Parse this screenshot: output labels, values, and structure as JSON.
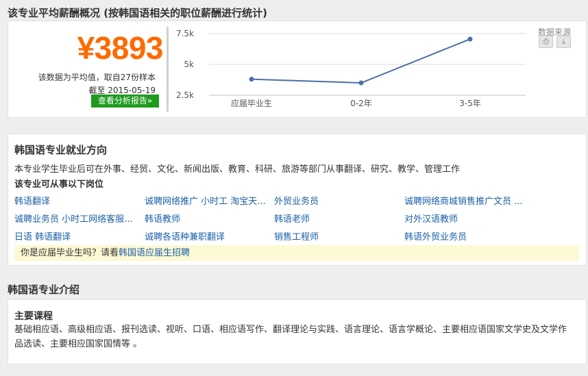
{
  "salary": {
    "section_title": "该专业平均薪酬概况 (按韩国语相关的职位薪酬进行统计)",
    "amount": "¥3893",
    "note_line1": "该数据为平均值，取自27份样本",
    "note_line2": "截至 2015-05-19",
    "report_button": "查看分析报告»",
    "source_label": "数据来源",
    "print_icon": "print-icon",
    "download_icon": "download-icon",
    "accent_color": "#ff6a00",
    "line_color": "#4b6ea8"
  },
  "chart_data": {
    "type": "line",
    "categories": [
      "应届毕业生",
      "0-2年",
      "3-5年"
    ],
    "series": [
      {
        "values": [
          3800,
          3500,
          7050
        ]
      }
    ],
    "y_ticks": [
      "7.5k",
      "5k",
      "2.5k"
    ],
    "ylim": [
      2500,
      7500
    ],
    "grid": true
  },
  "jobs": {
    "title": "韩国语专业就业方向",
    "description": "本专业学生毕业后可在外事、经贸、文化、新闻出版、教育、科研、旅游等部门从事翻译、研究、教学、管理工作",
    "subtitle": "该专业可从事以下岗位",
    "items": [
      "韩语翻译",
      "诚聘网络推广 小时工 淘宝天...",
      "外贸业务员",
      "诚聘网络商城销售推广文员 ...",
      "诚聘业务员 小时工网络客服...",
      "韩语教师",
      "韩语老师",
      "对外汉语教师",
      "日语 韩语翻译",
      "诚聘各语种兼职翻译",
      "销售工程师",
      "韩语外贸业务员"
    ],
    "notice_prefix": "你是应届毕业生吗？请看",
    "notice_link": "韩国语应届生招聘"
  },
  "intro": {
    "section_title": "韩国语专业介绍",
    "courses_title": "主要课程",
    "courses_text": "基础相应语、高级相应语、报刊选读、视听、口语、相应语写作、翻译理论与实践、语言理论、语言学概论、主要相应语国家文学史及文学作品选读、主要相应国家国情等 。"
  }
}
